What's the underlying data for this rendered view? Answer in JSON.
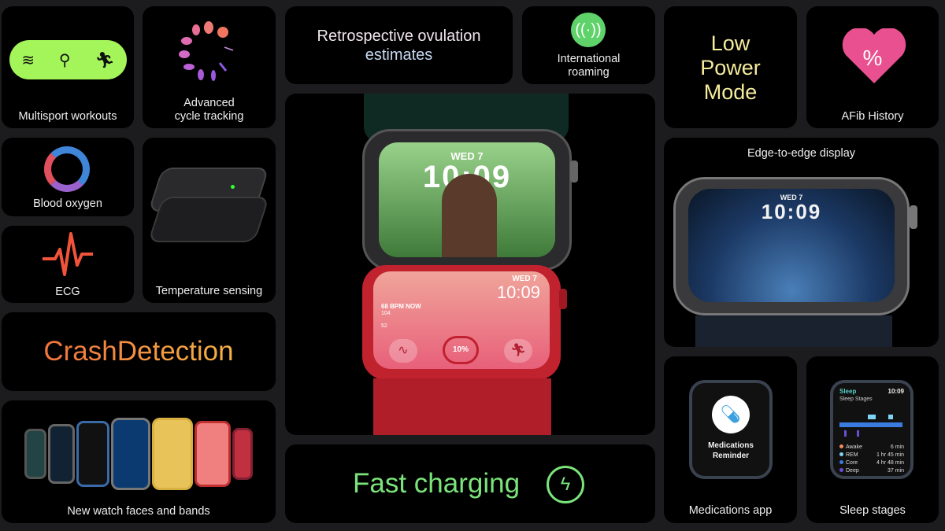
{
  "tiles": {
    "multisport": {
      "label": "Multisport workouts",
      "icons": [
        "swim-icon",
        "bike-icon",
        "run-icon"
      ],
      "accent": "#a4f55a"
    },
    "cycle": {
      "label_line1": "Advanced",
      "label_line2": "cycle tracking"
    },
    "ovulation": {
      "line1": "Retrospective ovulation",
      "line2": "estimates"
    },
    "roaming": {
      "line1": "International",
      "line2": "roaming",
      "accent": "#5fd36a"
    },
    "lowpower": {
      "line1": "Low",
      "line2": "Power",
      "line3": "Mode",
      "accent": "#f5ec9c"
    },
    "afib": {
      "label": "AFib History",
      "symbol": "%",
      "accent": "#e9508f"
    },
    "oxygen": {
      "label": "Blood oxygen"
    },
    "temperature": {
      "label": "Temperature sensing"
    },
    "ecg": {
      "label": "ECG",
      "accent": "#f2533b"
    },
    "crash": {
      "label": "CrashDetection",
      "accent": "#f08a3c"
    },
    "faces": {
      "label": "New watch faces and bands"
    },
    "hero": {
      "top_watch": {
        "day": "WED 7",
        "time": "10:09"
      },
      "bottom_watch": {
        "day": "WED 7",
        "time": "10:09",
        "bpm": "68 BPM NOW",
        "hi": "104",
        "lo": "52",
        "percent": "10%"
      }
    },
    "charging": {
      "label": "Fast charging",
      "accent": "#7be37b"
    },
    "edge": {
      "label": "Edge-to-edge display",
      "day": "WED 7",
      "time": "10:09"
    },
    "medications": {
      "label": "Medications app",
      "screen_line1": "Medications",
      "screen_line2": "Reminder"
    },
    "sleep": {
      "label": "Sleep stages",
      "screen_title": "Sleep",
      "screen_time": "10:09",
      "screen_sub": "Sleep Stages",
      "stages": [
        {
          "name": "Awake",
          "value": "6 min",
          "color": "#f08a5d"
        },
        {
          "name": "REM",
          "value": "1 hr 45 min",
          "color": "#7fd3f5"
        },
        {
          "name": "Core",
          "value": "4 hr 48 min",
          "color": "#3a7be0"
        },
        {
          "name": "Deep",
          "value": "37 min",
          "color": "#6b4fd8"
        }
      ]
    }
  }
}
